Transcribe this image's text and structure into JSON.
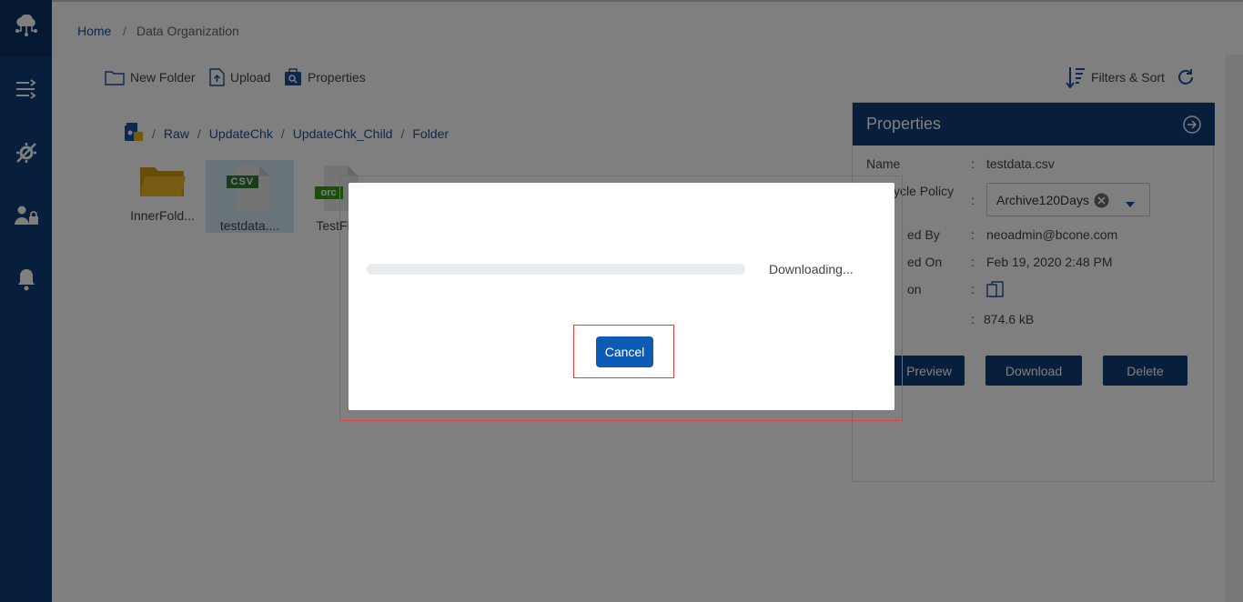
{
  "breadcrumb": {
    "home": "Home",
    "separator": "/",
    "current": "Data Organization"
  },
  "sidebar": {
    "logo_icon": "cloud-network-icon",
    "items": [
      {
        "icon": "shuffle-icon"
      },
      {
        "icon": "tools-icon"
      },
      {
        "icon": "user-lock-icon"
      },
      {
        "icon": "bell-icon"
      }
    ]
  },
  "toolbar": {
    "new_folder": "New Folder",
    "upload": "Upload",
    "properties": "Properties",
    "filters_sort": "Filters & Sort"
  },
  "path": {
    "segments": [
      "Raw",
      "UpdateChk",
      "UpdateChk_Child",
      "Folder"
    ],
    "separator": "/"
  },
  "files": [
    {
      "name": "InnerFold...",
      "type": "folder"
    },
    {
      "name": "testdata....",
      "type": "csv",
      "badge": "CSV",
      "selected": true
    },
    {
      "name": "TestFile",
      "type": "orc",
      "badge": "orc"
    }
  ],
  "properties": {
    "title": "Properties",
    "rows": [
      {
        "label": "Name",
        "value": "testdata.csv"
      },
      {
        "label": "ycle Policy",
        "value": "Archive120Days"
      },
      {
        "label": "ed By",
        "value": "neoadmin@bcone.com"
      },
      {
        "label": "ed On",
        "value": "Feb 19, 2020 2:48 PM"
      },
      {
        "label": "on",
        "value": ""
      },
      {
        "label": "",
        "value": "874.6 kB"
      }
    ],
    "colon": ":",
    "buttons": {
      "preview": "Preview",
      "download": "Download",
      "delete": "Delete"
    }
  },
  "modal": {
    "progress": 0,
    "status": "Downloading...",
    "cancel": "Cancel"
  },
  "colors": {
    "brand": "#0e3d78",
    "accent": "#0e5bb5",
    "highlight": "#e23c3c"
  }
}
